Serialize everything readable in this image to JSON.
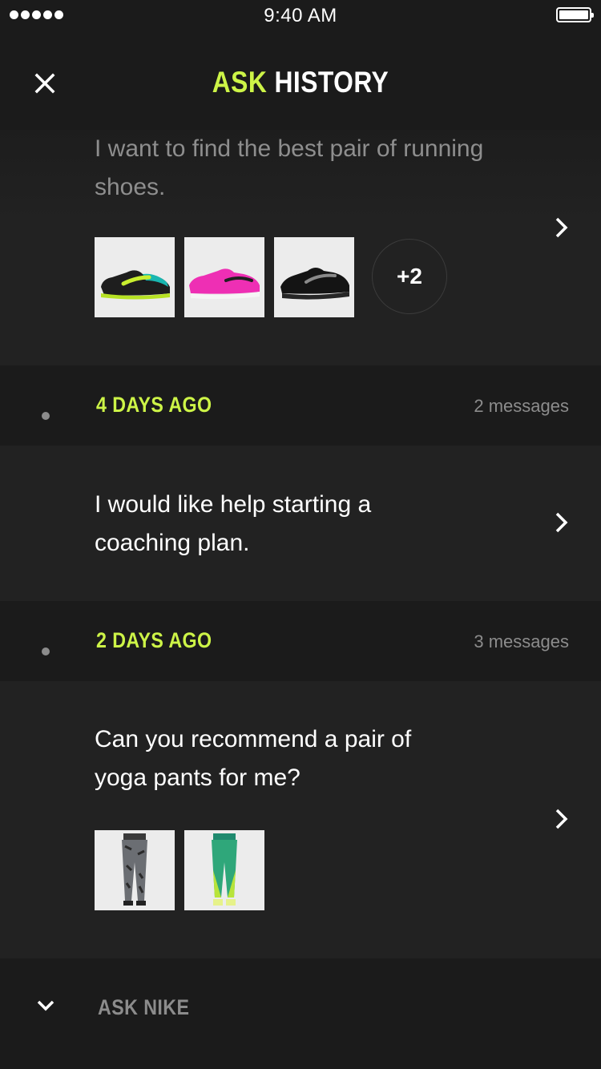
{
  "status_bar": {
    "time": "9:40 AM"
  },
  "nav": {
    "title_accent": "ASK",
    "title_rest": "HISTORY"
  },
  "conversations": [
    {
      "text": "I want to find the best pair of running shoes.",
      "products": [
        "running-shoe-teal",
        "running-shoe-pink",
        "running-shoe-black"
      ],
      "more_label": "+2"
    },
    {
      "date": "4 DAYS AGO",
      "count": "2 messages",
      "text": "I would like help starting a coaching plan."
    },
    {
      "date": "2 DAYS AGO",
      "count": "3 messages",
      "text": "Can you recommend a pair of yoga pants for me?",
      "products": [
        "yoga-pants-print",
        "yoga-pants-green"
      ]
    }
  ],
  "footer": {
    "label": "ASK NIKE"
  },
  "colors": {
    "accent": "#cdf447",
    "background": "#1b1b1b",
    "card": "#222222",
    "muted": "#8c8c8c"
  }
}
